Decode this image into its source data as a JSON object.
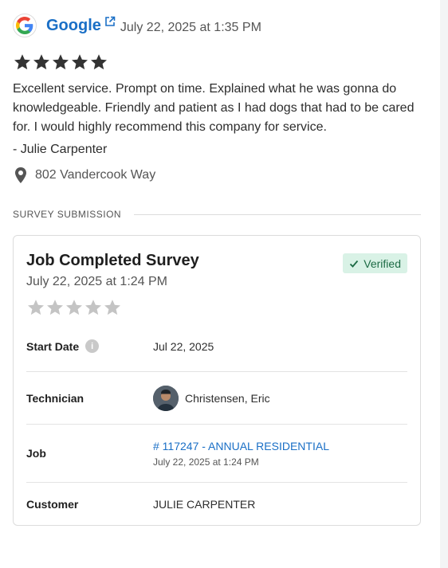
{
  "review": {
    "source": "Google",
    "date": "July 22, 2025 at 1:35 PM",
    "rating": 5,
    "text": "Excellent service. Prompt on time. Explained what he was gonna do knowledgeable. Friendly and patient as I had dogs that had to be cared for. I would highly recommend this company for service.",
    "author": "- Julie Carpenter",
    "address": "802 Vandercook Way"
  },
  "section": {
    "label": "SURVEY SUBMISSION"
  },
  "survey": {
    "title": "Job Completed Survey",
    "date": "July 22, 2025 at 1:24 PM",
    "badge": "Verified",
    "rating": 0,
    "rows": {
      "start_date": {
        "label": "Start Date",
        "value": "Jul 22, 2025"
      },
      "technician": {
        "label": "Technician",
        "value": "Christensen, Eric"
      },
      "job": {
        "label": "Job",
        "link": "# 117247 - ANNUAL RESIDENTIAL",
        "sub": "July 22, 2025 at 1:24 PM"
      },
      "customer": {
        "label": "Customer",
        "value": "JULIE CARPENTER"
      }
    }
  },
  "colors": {
    "link": "#1a6fc6",
    "star_filled": "#333333",
    "star_empty": "#c4c4c4",
    "verified_bg": "#d9f2e6",
    "verified_text": "#1d6b45"
  },
  "icons": {
    "source": "google-g-icon",
    "external": "external-link-icon",
    "star": "star-icon",
    "location": "map-pin-icon",
    "info": "info-icon",
    "check": "check-icon"
  }
}
